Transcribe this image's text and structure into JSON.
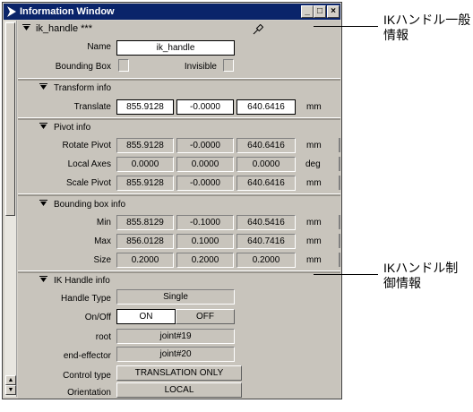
{
  "window": {
    "title": "Information Window"
  },
  "header": {
    "node_name": "ik_handle ***"
  },
  "general": {
    "name_label": "Name",
    "name_value": "ik_handle",
    "bbox_label": "Bounding Box",
    "invisible_label": "Invisible"
  },
  "transform": {
    "title": "Transform info",
    "translate_label": "Translate",
    "translate": [
      "855.9128",
      "-0.0000",
      "640.6416"
    ],
    "unit": "mm"
  },
  "pivot": {
    "title": "Pivot info",
    "rotate_label": "Rotate Pivot",
    "rotate": [
      "855.9128",
      "-0.0000",
      "640.6416"
    ],
    "rotate_unit": "mm",
    "axes_label": "Local Axes",
    "axes": [
      "0.0000",
      "0.0000",
      "0.0000"
    ],
    "axes_unit": "deg",
    "scale_label": "Scale Pivot",
    "scale": [
      "855.9128",
      "-0.0000",
      "640.6416"
    ],
    "scale_unit": "mm"
  },
  "bbox": {
    "title": "Bounding box info",
    "min_label": "Min",
    "min": [
      "855.8129",
      "-0.1000",
      "640.5416"
    ],
    "min_unit": "mm",
    "max_label": "Max",
    "max": [
      "856.0128",
      "0.1000",
      "640.7416"
    ],
    "max_unit": "mm",
    "size_label": "Size",
    "size": [
      "0.2000",
      "0.2000",
      "0.2000"
    ],
    "size_unit": "mm"
  },
  "ik": {
    "title": "IK Handle info",
    "type_label": "Handle Type",
    "type_value": "Single",
    "onoff_label": "On/Off",
    "on": "ON",
    "off": "OFF",
    "root_label": "root",
    "root_value": "joint#19",
    "effector_label": "end-effector",
    "effector_value": "joint#20",
    "control_label": "Control type",
    "control_value": "TRANSLATION ONLY",
    "orient_label": "Orientation",
    "orient_value": "LOCAL"
  },
  "annotations": {
    "a1_line1": "IKハンドル一般",
    "a1_line2": "情報",
    "a2_line1": "IKハンドル制",
    "a2_line2": "御情報"
  },
  "icons": [
    "menu-arrow-icon",
    "minimize-icon",
    "maximize-icon",
    "close-icon",
    "collapse-triangle-icon",
    "pin-icon",
    "scroll-up-icon",
    "scroll-down-icon"
  ],
  "colors": {
    "titlebar": "#0a246a",
    "panel": "#c8c4bc",
    "field_edit": "#ffffff"
  }
}
